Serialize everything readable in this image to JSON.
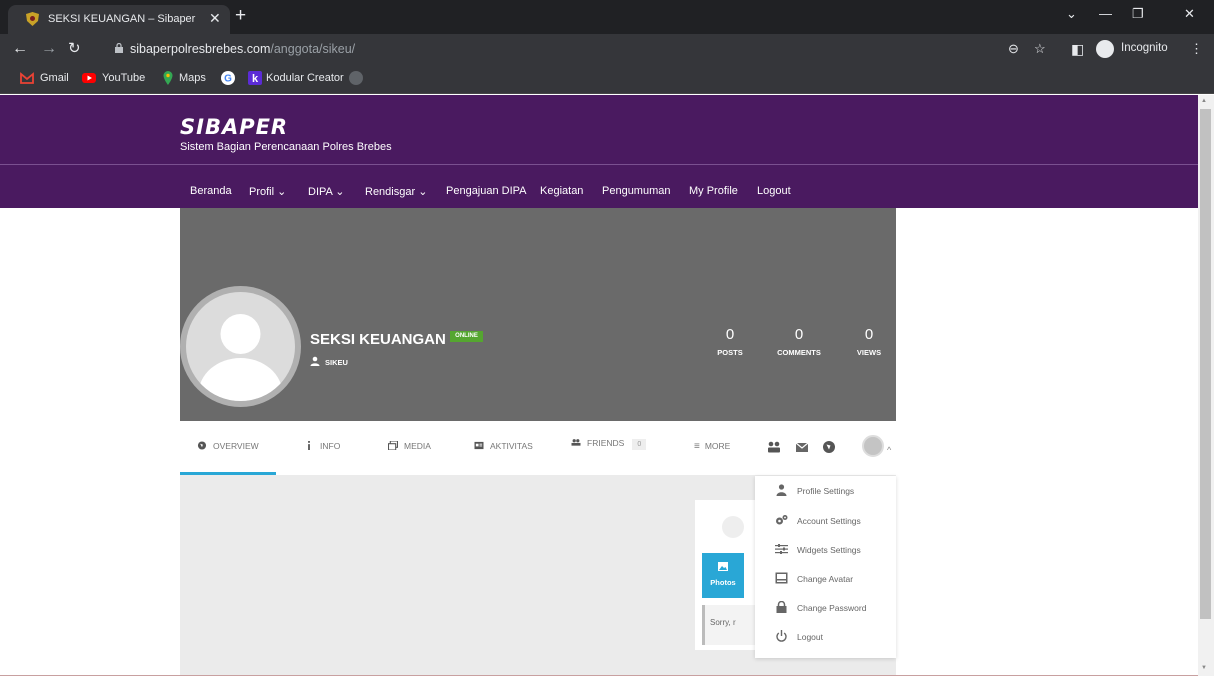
{
  "browser": {
    "tab_title": "SEKSI KEUANGAN – Sibaper",
    "url_domain": "sibaperpolresbrebes.com",
    "url_path": "/anggota/sikeu/",
    "incognito_label": "Incognito",
    "bookmarks": [
      {
        "label": "Gmail",
        "icon": "gmail-icon"
      },
      {
        "label": "YouTube",
        "icon": "youtube-icon"
      },
      {
        "label": "Maps",
        "icon": "maps-icon"
      },
      {
        "label": "",
        "icon": "google-icon"
      },
      {
        "label": "Kodular Creator",
        "icon": "kodular-icon"
      }
    ]
  },
  "site": {
    "brand": "SIBAPER",
    "tagline": "Sistem Bagian Perencanaan Polres Brebes",
    "menu": [
      "Beranda",
      "Profil ⌄",
      "DIPA ⌄",
      "Rendisgar ⌄",
      "Pengajuan DIPA",
      "Kegiatan",
      "Pengumuman",
      "My Profile",
      "Logout"
    ]
  },
  "profile": {
    "name": "SEKSI KEUANGAN",
    "status_badge": "ONLINE",
    "username": "SIKEU",
    "stats": [
      {
        "value": "0",
        "label": "POSTS"
      },
      {
        "value": "0",
        "label": "COMMENTS"
      },
      {
        "value": "0",
        "label": "VIEWS"
      }
    ],
    "nav": {
      "overview": "OVERVIEW",
      "info": "INFO",
      "media": "MEDIA",
      "aktivitas": "AKTIVITAS",
      "friends": "FRIENDS",
      "friends_count": "0",
      "more": "MORE"
    },
    "active_tab_color": "#29a7d6"
  },
  "widget": {
    "photos_label": "Photos",
    "sorry_text": "Sorry, r"
  },
  "dropdown": [
    {
      "label": "Profile Settings",
      "icon": "user-icon"
    },
    {
      "label": "Account Settings",
      "icon": "gears-icon"
    },
    {
      "label": "Widgets Settings",
      "icon": "sliders-icon"
    },
    {
      "label": "Change Avatar",
      "icon": "image-icon"
    },
    {
      "label": "Change Password",
      "icon": "lock-icon"
    },
    {
      "label": "Logout",
      "icon": "power-icon"
    }
  ],
  "colors": {
    "header_purple": "#4a1a60",
    "accent_blue": "#29a7d6",
    "online_green": "#55a630"
  }
}
